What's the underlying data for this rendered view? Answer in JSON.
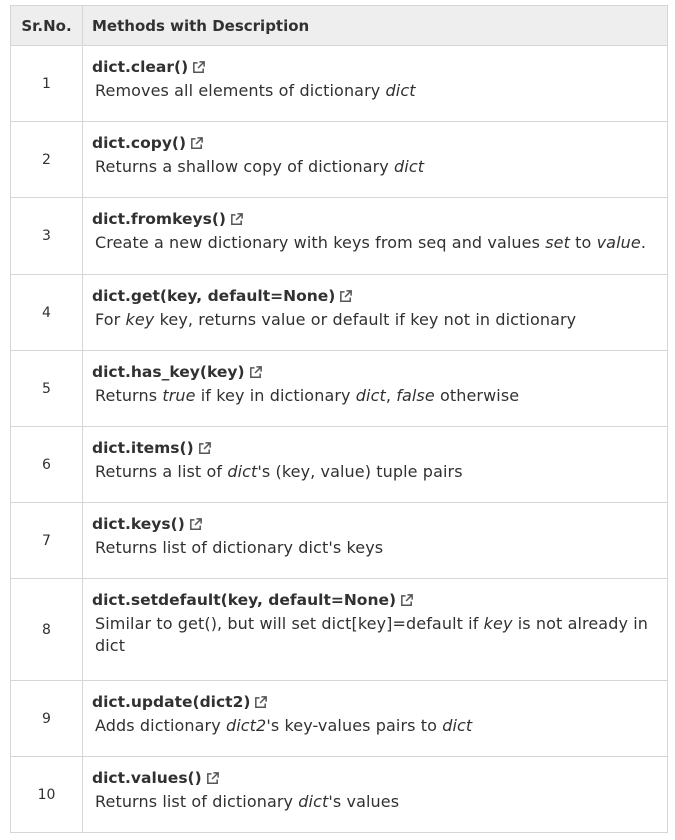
{
  "header": {
    "num": "Sr.No.",
    "desc": "Methods with Description"
  },
  "icons": {
    "method_link": "external-link-icon"
  },
  "rows": [
    {
      "num": "1",
      "method": "dict.clear()",
      "desc": [
        {
          "t": "Removes all elements of dictionary ",
          "i": false
        },
        {
          "t": "dict",
          "i": true
        }
      ]
    },
    {
      "num": "2",
      "method": "dict.copy()",
      "desc": [
        {
          "t": "Returns a shallow copy of dictionary ",
          "i": false
        },
        {
          "t": "dict",
          "i": true
        }
      ]
    },
    {
      "num": "3",
      "method": "dict.fromkeys()",
      "desc": [
        {
          "t": "Create a new dictionary with keys from seq and values ",
          "i": false
        },
        {
          "t": "set",
          "i": true
        },
        {
          "t": " to ",
          "i": false
        },
        {
          "t": "value",
          "i": true
        },
        {
          "t": ".",
          "i": false
        }
      ]
    },
    {
      "num": "4",
      "method": "dict.get(key, default=None)",
      "desc": [
        {
          "t": "For ",
          "i": false
        },
        {
          "t": "key",
          "i": true
        },
        {
          "t": " key, returns value or default if key not in dictionary",
          "i": false
        }
      ]
    },
    {
      "num": "5",
      "method": "dict.has_key(key)",
      "desc": [
        {
          "t": "Returns ",
          "i": false
        },
        {
          "t": "true",
          "i": true
        },
        {
          "t": " if key in dictionary ",
          "i": false
        },
        {
          "t": "dict",
          "i": true
        },
        {
          "t": ", ",
          "i": false
        },
        {
          "t": "false",
          "i": true
        },
        {
          "t": " otherwise",
          "i": false
        }
      ]
    },
    {
      "num": "6",
      "method": "dict.items()",
      "desc": [
        {
          "t": "Returns a list of ",
          "i": false
        },
        {
          "t": "dict",
          "i": true
        },
        {
          "t": "'s (key, value) tuple pairs",
          "i": false
        }
      ]
    },
    {
      "num": "7",
      "method": "dict.keys()",
      "desc": [
        {
          "t": "Returns list of dictionary dict's keys",
          "i": false
        }
      ]
    },
    {
      "num": "8",
      "method": "dict.setdefault(key, default=None)",
      "desc": [
        {
          "t": "Similar to get(), but will set dict[key]=default if ",
          "i": false
        },
        {
          "t": "key",
          "i": true
        },
        {
          "t": " is not already in dict",
          "i": false
        }
      ]
    },
    {
      "num": "9",
      "method": "dict.update(dict2)",
      "desc": [
        {
          "t": "Adds dictionary ",
          "i": false
        },
        {
          "t": "dict2",
          "i": true
        },
        {
          "t": "'s key-values pairs to ",
          "i": false
        },
        {
          "t": "dict",
          "i": true
        }
      ]
    },
    {
      "num": "10",
      "method": "dict.values()",
      "desc": [
        {
          "t": "Returns list of dictionary ",
          "i": false
        },
        {
          "t": "dict",
          "i": true
        },
        {
          "t": "'s values",
          "i": false
        }
      ]
    }
  ]
}
